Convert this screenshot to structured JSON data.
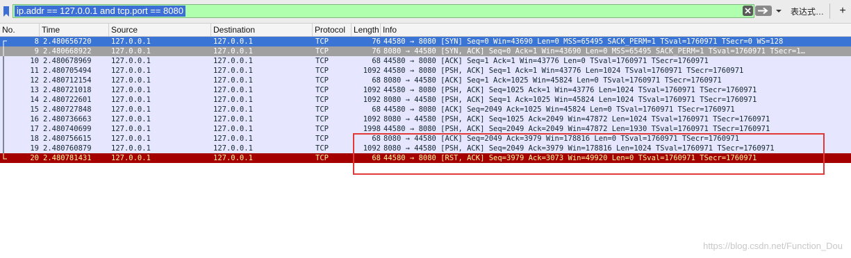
{
  "filter": {
    "expression": "ip.addr == 127.0.0.1 and tcp.port == 8080",
    "expression_label": "表达式…",
    "add_label": "+"
  },
  "columns": [
    "No.",
    "Time",
    "Source",
    "Destination",
    "Protocol",
    "Length",
    "Info"
  ],
  "packets": [
    {
      "no": "8",
      "time": "2.480656720",
      "src": "127.0.0.1",
      "dst": "127.0.0.1",
      "proto": "TCP",
      "len": "76",
      "info": "44580 → 8080 [SYN] Seq=0 Win=43690 Len=0 MSS=65495 SACK_PERM=1 TSval=1760971 TSecr=0 WS=128",
      "style": "sel"
    },
    {
      "no": "9",
      "time": "2.480668922",
      "src": "127.0.0.1",
      "dst": "127.0.0.1",
      "proto": "TCP",
      "len": "76",
      "info": "8080 → 44580 [SYN, ACK] Seq=0 Ack=1 Win=43690 Len=0 MSS=65495 SACK_PERM=1 TSval=1760971 TSecr=1…",
      "style": "gray"
    },
    {
      "no": "10",
      "time": "2.480678969",
      "src": "127.0.0.1",
      "dst": "127.0.0.1",
      "proto": "TCP",
      "len": "68",
      "info": "44580 → 8080 [ACK] Seq=1 Ack=1 Win=43776 Len=0 TSval=1760971 TSecr=1760971",
      "style": "normal"
    },
    {
      "no": "11",
      "time": "2.480705494",
      "src": "127.0.0.1",
      "dst": "127.0.0.1",
      "proto": "TCP",
      "len": "1092",
      "info": "44580 → 8080 [PSH, ACK] Seq=1 Ack=1 Win=43776 Len=1024 TSval=1760971 TSecr=1760971",
      "style": "normal"
    },
    {
      "no": "12",
      "time": "2.480712154",
      "src": "127.0.0.1",
      "dst": "127.0.0.1",
      "proto": "TCP",
      "len": "68",
      "info": "8080 → 44580 [ACK] Seq=1 Ack=1025 Win=45824 Len=0 TSval=1760971 TSecr=1760971",
      "style": "normal"
    },
    {
      "no": "13",
      "time": "2.480721018",
      "src": "127.0.0.1",
      "dst": "127.0.0.1",
      "proto": "TCP",
      "len": "1092",
      "info": "44580 → 8080 [PSH, ACK] Seq=1025 Ack=1 Win=43776 Len=1024 TSval=1760971 TSecr=1760971",
      "style": "normal"
    },
    {
      "no": "14",
      "time": "2.480722601",
      "src": "127.0.0.1",
      "dst": "127.0.0.1",
      "proto": "TCP",
      "len": "1092",
      "info": "8080 → 44580 [PSH, ACK] Seq=1 Ack=1025 Win=45824 Len=1024 TSval=1760971 TSecr=1760971",
      "style": "normal"
    },
    {
      "no": "15",
      "time": "2.480727848",
      "src": "127.0.0.1",
      "dst": "127.0.0.1",
      "proto": "TCP",
      "len": "68",
      "info": "44580 → 8080 [ACK] Seq=2049 Ack=1025 Win=45824 Len=0 TSval=1760971 TSecr=1760971",
      "style": "normal"
    },
    {
      "no": "16",
      "time": "2.480736663",
      "src": "127.0.0.1",
      "dst": "127.0.0.1",
      "proto": "TCP",
      "len": "1092",
      "info": "8080 → 44580 [PSH, ACK] Seq=1025 Ack=2049 Win=47872 Len=1024 TSval=1760971 TSecr=1760971",
      "style": "normal"
    },
    {
      "no": "17",
      "time": "2.480740699",
      "src": "127.0.0.1",
      "dst": "127.0.0.1",
      "proto": "TCP",
      "len": "1998",
      "info": "44580 → 8080 [PSH, ACK] Seq=2049 Ack=2049 Win=47872 Len=1930 TSval=1760971 TSecr=1760971",
      "style": "normal"
    },
    {
      "no": "18",
      "time": "2.480756615",
      "src": "127.0.0.1",
      "dst": "127.0.0.1",
      "proto": "TCP",
      "len": "68",
      "info": "8080 → 44580 [ACK] Seq=2049 Ack=3979 Win=178816 Len=0 TSval=1760971 TSecr=1760971",
      "style": "normal"
    },
    {
      "no": "19",
      "time": "2.480760879",
      "src": "127.0.0.1",
      "dst": "127.0.0.1",
      "proto": "TCP",
      "len": "1092",
      "info": "8080 → 44580 [PSH, ACK] Seq=2049 Ack=3979 Win=178816 Len=1024 TSval=1760971 TSecr=1760971",
      "style": "normal"
    },
    {
      "no": "20",
      "time": "2.480781431",
      "src": "127.0.0.1",
      "dst": "127.0.0.1",
      "proto": "TCP",
      "len": "68",
      "info": "44580 → 8080 [RST, ACK] Seq=3979 Ack=3073 Win=49920 Len=0 TSval=1760971 TSecr=1760971",
      "style": "rst"
    }
  ],
  "watermark": "https://blog.csdn.net/Function_Dou",
  "colors": {
    "filter_valid": "#afffaf",
    "selected_row": "#3a74d4",
    "rst_row": "#a40000",
    "tcp_row": "#e7e6ff",
    "annotation": "#e23838"
  }
}
